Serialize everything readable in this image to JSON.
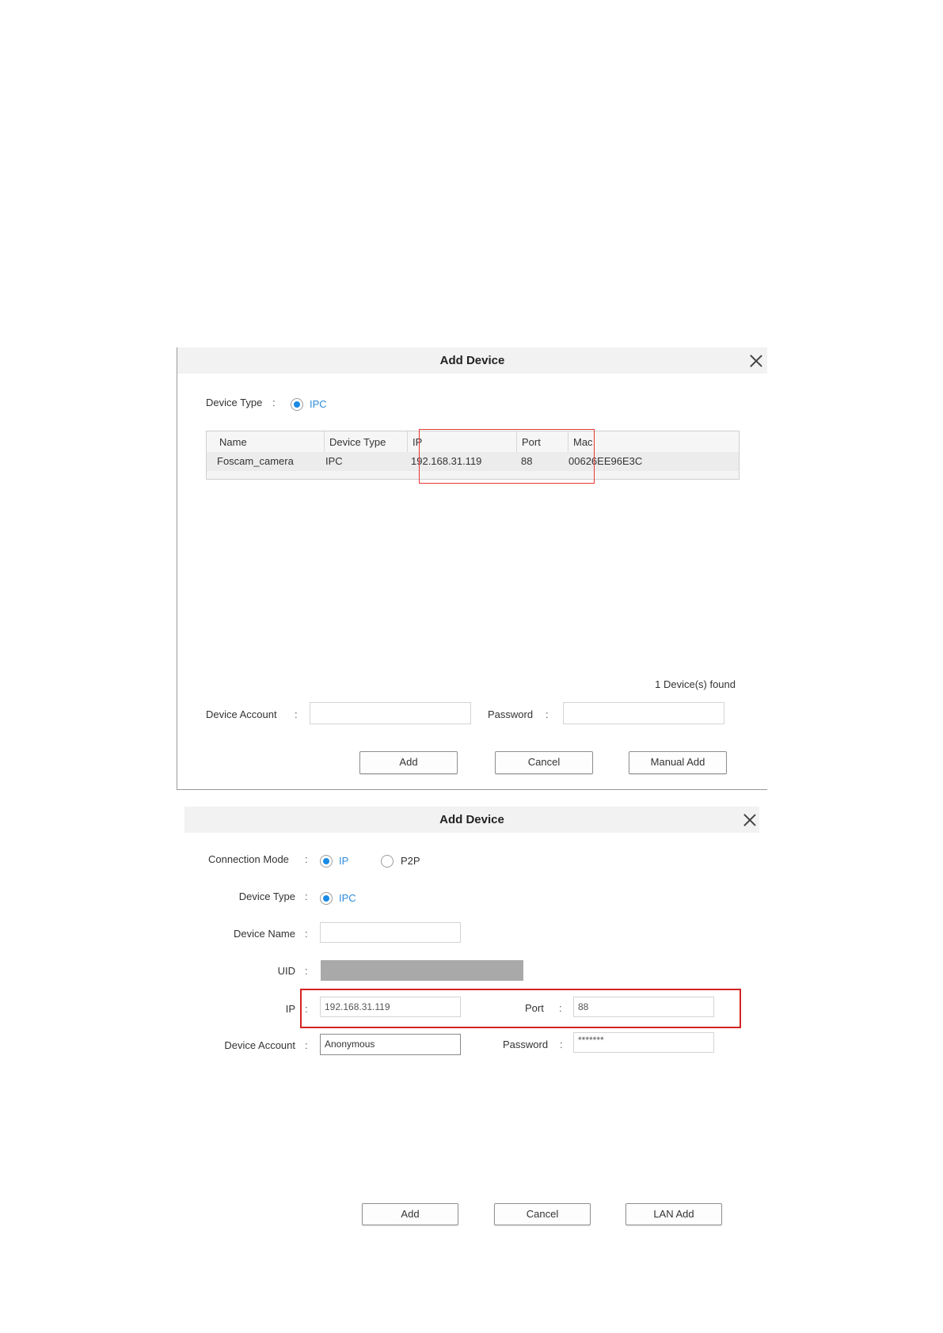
{
  "dialog_scan": {
    "title": "Add Device",
    "device_type_label": "Device Type",
    "colon": ":",
    "device_type_value": "IPC",
    "table": {
      "headers": [
        "Name",
        "Device Type",
        "IP",
        "Port",
        "Mac"
      ],
      "rows": [
        [
          "Foscam_camera",
          "IPC",
          "192.168.31.119",
          "88",
          "00626EE96E3C"
        ]
      ]
    },
    "found_text": "1  Device(s) found",
    "device_account_label": "Device Account",
    "device_account_value": "",
    "password_label": "Password",
    "password_value": "",
    "buttons": {
      "add": "Add",
      "cancel": "Cancel",
      "manual_add": "Manual Add"
    }
  },
  "dialog_manual": {
    "title": "Add Device",
    "colon": ":",
    "connection_mode_label": "Connection Mode",
    "connection_mode_options": [
      "IP",
      "P2P"
    ],
    "connection_mode_selected": "IP",
    "device_type_label": "Device Type",
    "device_type_value": "IPC",
    "device_name_label": "Device Name",
    "device_name_value": "",
    "uid_label": "UID",
    "ip_label": "IP",
    "ip_value": "192.168.31.119",
    "port_label": "Port",
    "port_value": "88",
    "device_account_label": "Device Account",
    "device_account_value": "Anonymous",
    "password_label": "Password",
    "password_value": "*******",
    "buttons": {
      "add": "Add",
      "cancel": "Cancel",
      "lan_add": "LAN Add"
    }
  },
  "colors": {
    "accent_blue": "#1a8ae5",
    "highlight_red": "#e53935",
    "titlebar_bg": "#f2f2f2"
  }
}
